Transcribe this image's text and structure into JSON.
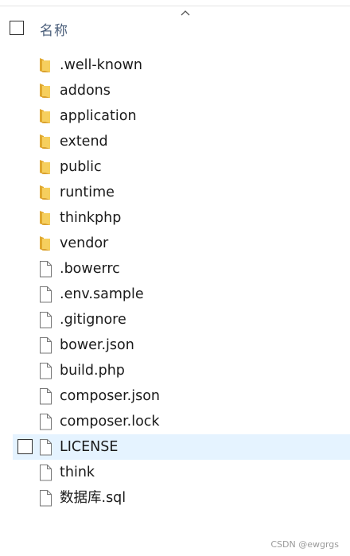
{
  "header": {
    "column_name": "名称"
  },
  "files": [
    {
      "name": ".well-known",
      "type": "folder"
    },
    {
      "name": "addons",
      "type": "folder"
    },
    {
      "name": "application",
      "type": "folder"
    },
    {
      "name": "extend",
      "type": "folder"
    },
    {
      "name": "public",
      "type": "folder"
    },
    {
      "name": "runtime",
      "type": "folder"
    },
    {
      "name": "thinkphp",
      "type": "folder"
    },
    {
      "name": "vendor",
      "type": "folder"
    },
    {
      "name": ".bowerrc",
      "type": "file"
    },
    {
      "name": ".env.sample",
      "type": "file"
    },
    {
      "name": ".gitignore",
      "type": "file"
    },
    {
      "name": "bower.json",
      "type": "file"
    },
    {
      "name": "build.php",
      "type": "file"
    },
    {
      "name": "composer.json",
      "type": "file"
    },
    {
      "name": "composer.lock",
      "type": "file"
    },
    {
      "name": "LICENSE",
      "type": "file",
      "selected": true
    },
    {
      "name": "think",
      "type": "file"
    },
    {
      "name": "数据库.sql",
      "type": "file"
    }
  ],
  "icons": {
    "folder": "folder-icon",
    "file": "file-icon",
    "sort": "sort-ascending-icon"
  },
  "colors": {
    "selection": "#e5f3ff",
    "folder": "#f0c14a",
    "header_text": "#4a5e7a"
  },
  "watermark": "CSDN @ewgrgs"
}
